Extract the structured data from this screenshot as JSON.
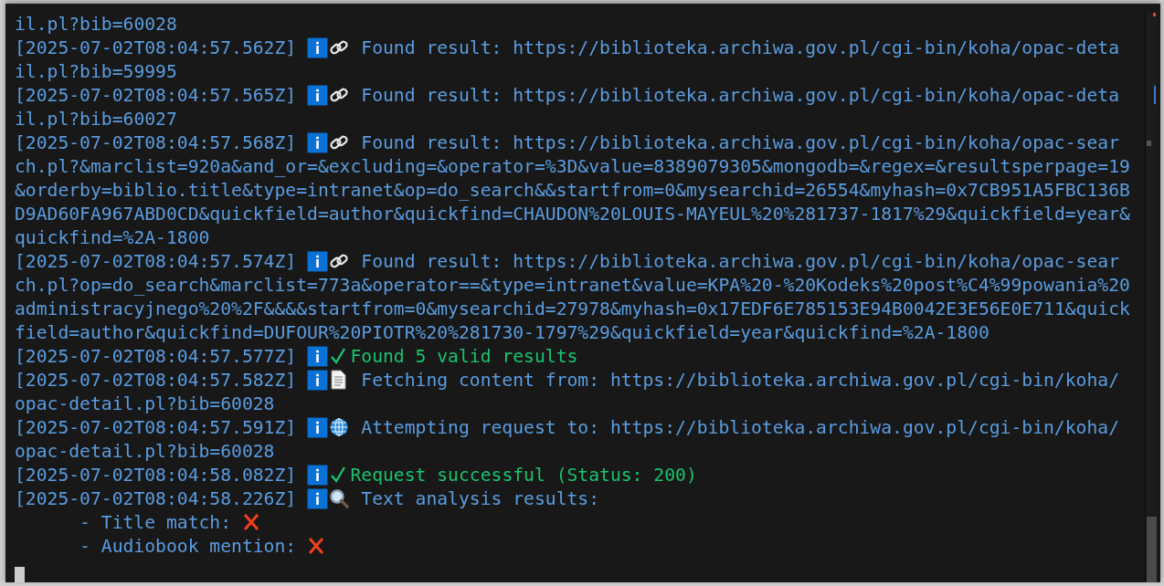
{
  "terminal": {
    "lines": [
      {
        "kind": "continuation",
        "text": "il.pl?bib=60028"
      },
      {
        "kind": "found",
        "timestamp": "[2025-07-02T08:04:57.562Z]",
        "message": "Found result: https://biblioteka.archiwa.gov.pl/cgi-bin/koha/opac-detail.pl?bib=59995"
      },
      {
        "kind": "found",
        "timestamp": "[2025-07-02T08:04:57.565Z]",
        "message": "Found result: https://biblioteka.archiwa.gov.pl/cgi-bin/koha/opac-detail.pl?bib=60027"
      },
      {
        "kind": "found",
        "timestamp": "[2025-07-02T08:04:57.568Z]",
        "message": "Found result: https://biblioteka.archiwa.gov.pl/cgi-bin/koha/opac-search.pl?&marclist=920a&and_or=&excluding=&operator=%3D&value=8389079305&mongodb=&regex=&resultsperpage=19&orderby=biblio.title&type=intranet&op=do_search&&startfrom=0&mysearchid=26554&myhash=0x7CB951A5FBC136BD9AD60FA967ABD0CD&quickfield=author&quickfind=CHAUDON%20LOUIS-MAYEUL%20%281737-1817%29&quickfield=year&quickfind=%2A-1800"
      },
      {
        "kind": "found",
        "timestamp": "[2025-07-02T08:04:57.574Z]",
        "message": "Found result: https://biblioteka.archiwa.gov.pl/cgi-bin/koha/opac-search.pl?op=do_search&marclist=773a&operator==&type=intranet&value=KPA%20-%20Kodeks%20post%C4%99powania%20administracyjnego%20%2F&&&&startfrom=0&mysearchid=27978&myhash=0x17EDF6E785153E94B0042E3E56E0E711&quickfield=author&quickfind=DUFOUR%20PIOTR%20%281730-1797%29&quickfield=year&quickfind=%2A-1800"
      },
      {
        "kind": "success",
        "timestamp": "[2025-07-02T08:04:57.577Z]",
        "message": "Found 5 valid results"
      },
      {
        "kind": "fetch",
        "timestamp": "[2025-07-02T08:04:57.582Z]",
        "message": "Fetching content from: https://biblioteka.archiwa.gov.pl/cgi-bin/koha/opac-detail.pl?bib=60028"
      },
      {
        "kind": "request",
        "timestamp": "[2025-07-02T08:04:57.591Z]",
        "message": "Attempting request to: https://biblioteka.archiwa.gov.pl/cgi-bin/koha/opac-detail.pl?bib=60028"
      },
      {
        "kind": "success",
        "timestamp": "[2025-07-02T08:04:58.082Z]",
        "message": "Request successful (Status: 200)"
      },
      {
        "kind": "analysis",
        "timestamp": "[2025-07-02T08:04:58.226Z]",
        "message": "Text analysis results:"
      },
      {
        "kind": "detail",
        "label": "- Title match:"
      },
      {
        "kind": "detail",
        "label": "- Audiobook mention:"
      }
    ]
  }
}
